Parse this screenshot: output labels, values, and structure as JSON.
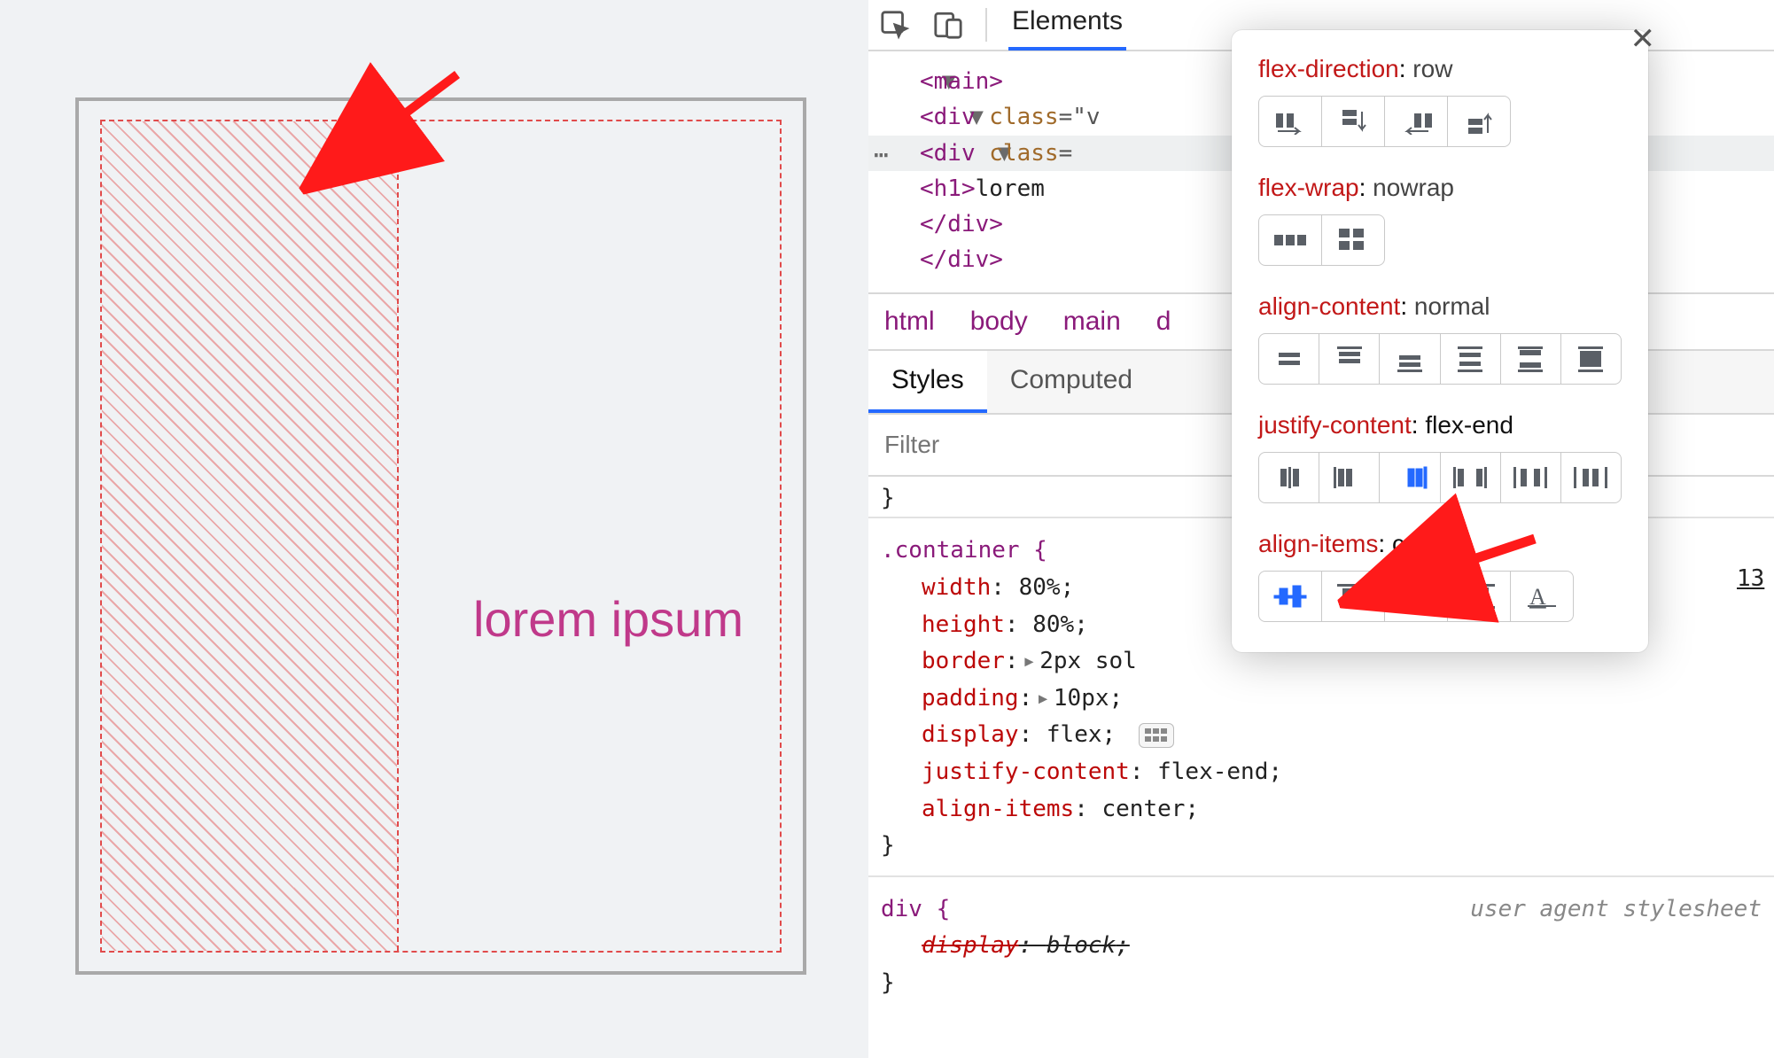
{
  "preview": {
    "text": "lorem ipsum"
  },
  "toolbar": {
    "tab_elements": "Elements"
  },
  "dom": {
    "main": "<main>",
    "div1_open": "<",
    "div1_name": "div ",
    "div1_attr": "class",
    "div1_after": "=\"v",
    "div2_open": "<",
    "div2_name": "div ",
    "div2_attr": "class",
    "div2_after": "=",
    "h1_open": "<",
    "h1_name": "h1",
    "h1_close": ">",
    "h1_text": "lorem",
    "div_close1": "</div>",
    "div_close2": "</div>"
  },
  "crumbs": {
    "c1": "html",
    "c2": "body",
    "c3": "main",
    "c4": "d"
  },
  "stylesTabs": {
    "styles": "Styles",
    "computed": "Computed"
  },
  "filter": {
    "placeholder": "Filter"
  },
  "css": {
    "brace_close_top": "}",
    "container_sel": ".container {",
    "p1": "width",
    "v1": "80%",
    "p2": "height",
    "v2": "80%",
    "p3": "border",
    "v3": "2px sol",
    "p4": "padding",
    "v4": "10px",
    "p5": "display",
    "v5": "flex",
    "p6": "justify-content",
    "v6": "flex-end",
    "p7": "align-items",
    "v7": "center",
    "container_close": "}",
    "div_sel": "div {",
    "ua_note": "user agent stylesheet",
    "p8": "display",
    "v8": "block",
    "div_close": "}"
  },
  "flexpop": {
    "g1_label": "flex-direction",
    "g1_value": "row",
    "g2_label": "flex-wrap",
    "g2_value": "nowrap",
    "g3_label": "align-content",
    "g3_value": "normal",
    "g4_label": "justify-content",
    "g4_value": "flex-end",
    "g5_label": "align-items",
    "g5_value": "center"
  },
  "misc": {
    "link13": "13"
  }
}
